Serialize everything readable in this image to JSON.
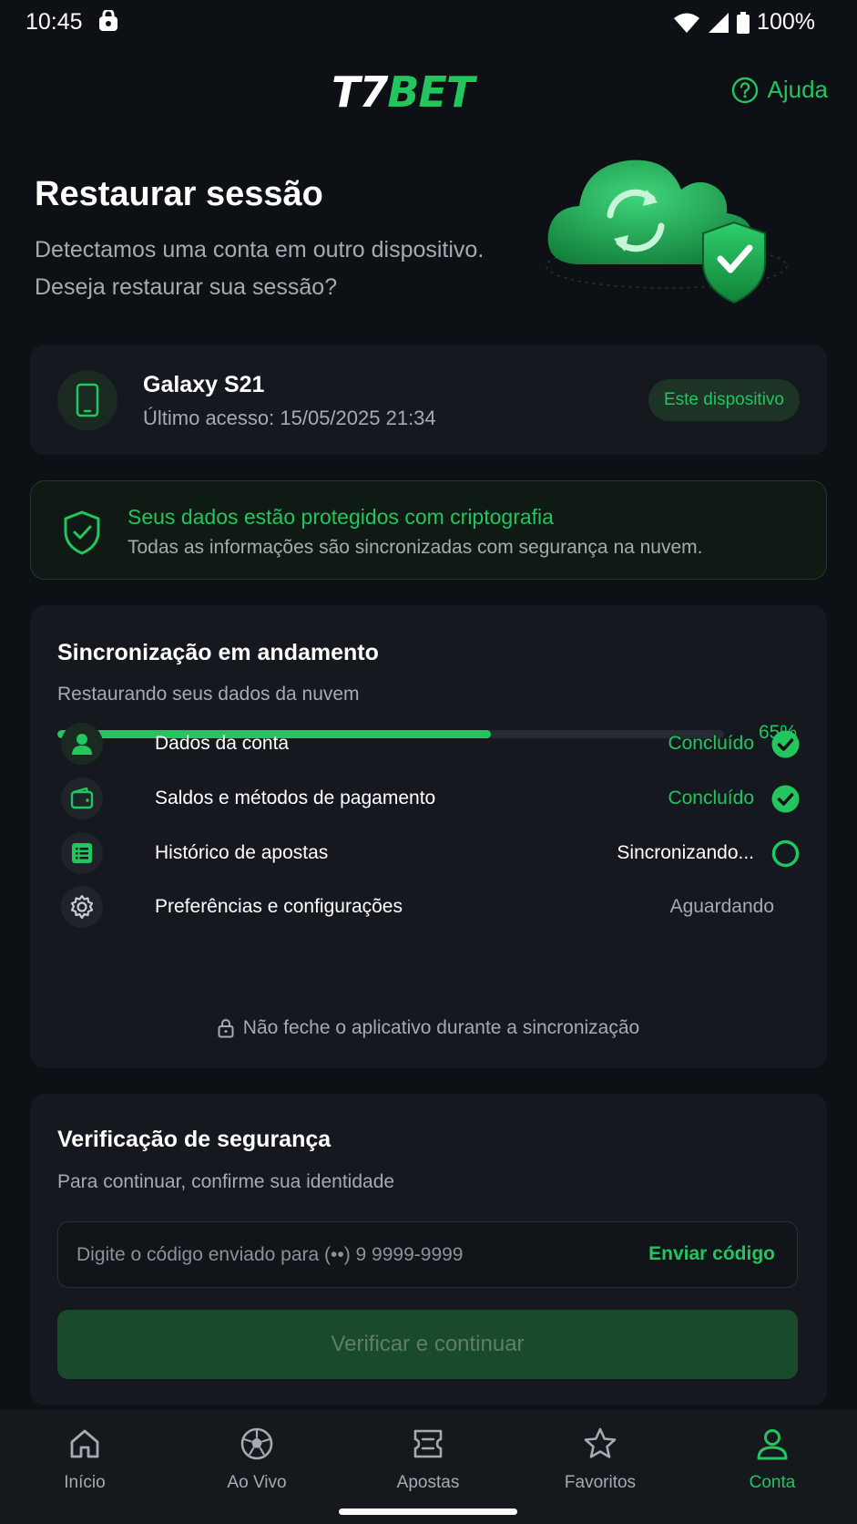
{
  "status_bar": {
    "time": "10:45",
    "battery": "100%"
  },
  "header": {
    "logo_part1": "T7",
    "logo_part2": "BET",
    "help_label": "Ajuda"
  },
  "hero": {
    "title": "Restaurar sessão",
    "subtitle_line1": "Detectamos uma conta em outro dispositivo.",
    "subtitle_line2": "Deseja restaurar sua sessão?"
  },
  "device": {
    "name": "Galaxy S21",
    "last_access": "Último acesso: 15/05/2025 21:34",
    "badge": "Este dispositivo"
  },
  "security_notice": {
    "title": "Seus dados estão protegidos com criptografia",
    "text": "Todas as informações são sincronizadas com segurança na nuvem."
  },
  "sync": {
    "title": "Sincronização em andamento",
    "subtitle": "Restaurando seus dados da nuvem",
    "progress": 0.65,
    "progress_label": "65%",
    "items": [
      {
        "label": "Dados da conta",
        "status": "Concluído",
        "state": "done",
        "icon": "user-icon"
      },
      {
        "label": "Saldos e métodos de pagamento",
        "status": "Concluído",
        "state": "done",
        "icon": "wallet-icon"
      },
      {
        "label": "Histórico de apostas",
        "status": "Sincronizando...",
        "state": "syncing",
        "icon": "list-icon"
      },
      {
        "label": "Preferências e configurações",
        "status": "Aguardando",
        "state": "waiting",
        "icon": "gear-icon"
      }
    ],
    "note": "Não feche o aplicativo durante a sincronização"
  },
  "verification": {
    "title": "Verificação de segurança",
    "subtitle": "Para continuar, confirme sua identidade",
    "input_placeholder": "Digite o código enviado para (••) 9 9999-9999",
    "send_code_label": "Enviar código",
    "button_label": "Verificar e continuar"
  },
  "bottom_nav": [
    {
      "label": "Início",
      "icon": "home-icon",
      "active": false
    },
    {
      "label": "Ao Vivo",
      "icon": "soccer-ball-icon",
      "active": false
    },
    {
      "label": "Apostas",
      "icon": "ticket-icon",
      "active": false
    },
    {
      "label": "Favoritos",
      "icon": "star-icon",
      "active": false
    },
    {
      "label": "Conta",
      "icon": "user-icon",
      "active": true
    }
  ],
  "colors": {
    "accent": "#22c55e",
    "background": "#0d1014",
    "card": "#15191f"
  }
}
